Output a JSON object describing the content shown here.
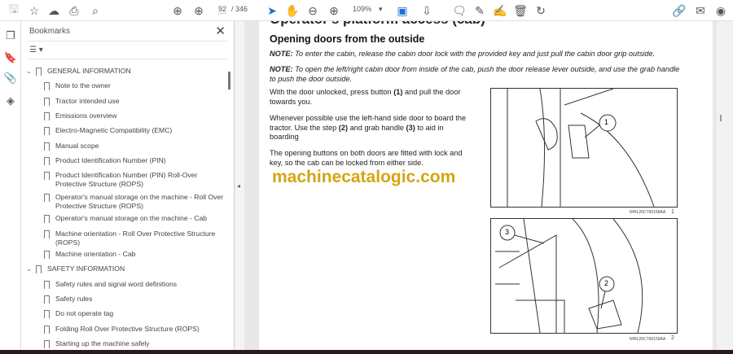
{
  "toolbar": {
    "page_current": "92",
    "page_total": "/ 346",
    "zoom": "109%"
  },
  "bookmarks": {
    "title": "Bookmarks",
    "close": "✕",
    "items": [
      {
        "label": "GENERAL INFORMATION",
        "level": 0
      },
      {
        "label": "Note to the owner",
        "level": 1
      },
      {
        "label": "Tractor intended use",
        "level": 1
      },
      {
        "label": "Emissions overview",
        "level": 1
      },
      {
        "label": "Electro-Magnetic Compatibility (EMC)",
        "level": 1
      },
      {
        "label": "Manual scope",
        "level": 1
      },
      {
        "label": "Product Identification Number (PIN)",
        "level": 1
      },
      {
        "label": "Product Identification Number (PIN) Roll-Over Protective Structure (ROPS)",
        "level": 1
      },
      {
        "label": "Operator's manual storage on the machine - Roll Over Protective Structure (ROPS)",
        "level": 1
      },
      {
        "label": "Operator's manual storage on the machine - Cab",
        "level": 1
      },
      {
        "label": "Machine orientation - Roll Over Protective Structure (ROPS)",
        "level": 1
      },
      {
        "label": "Machine orientation - Cab",
        "level": 1
      },
      {
        "label": "SAFETY INFORMATION",
        "level": 0
      },
      {
        "label": "Safety rules and signal word definitions",
        "level": 1
      },
      {
        "label": "Safety rules",
        "level": 1
      },
      {
        "label": "Do not operate tag",
        "level": 1
      },
      {
        "label": "Folding Roll Over Protective Structure (ROPS)",
        "level": 1
      },
      {
        "label": "Starting up the machine safely",
        "level": 1
      }
    ]
  },
  "document": {
    "section_title": "Operator's platform access (cab)",
    "heading": "Opening doors from the outside",
    "note1_label": "NOTE:",
    "note1": " To enter the cabin, release the cabin door lock with the provided key and just pull the cabin door grip outside.",
    "note2_label": "NOTE:",
    "note2": " To open the left/right cabin door from inside of the cab, push the door release lever outside, and use the grab handle to push the door outside.",
    "p1": [
      "With the door unlocked, press button ",
      "(1)",
      " and pull the door towards you."
    ],
    "p2": [
      "Whenever possible use the left-hand side door to board the tractor. Use the step ",
      "(2)",
      " and grab handle ",
      "(3)",
      " to aid in boarding"
    ],
    "p3": "The opening buttons on both doors are fitted with lock and key, so the cab can be locked from either side.",
    "watermark": "machinecatalogic.com",
    "fig1": {
      "code": "NHIL20CT00158AA",
      "num": "1",
      "callouts": [
        "1"
      ]
    },
    "fig2": {
      "code": "NHIL20CT00159AA",
      "num": "2",
      "callouts": [
        "3",
        "2"
      ]
    }
  }
}
